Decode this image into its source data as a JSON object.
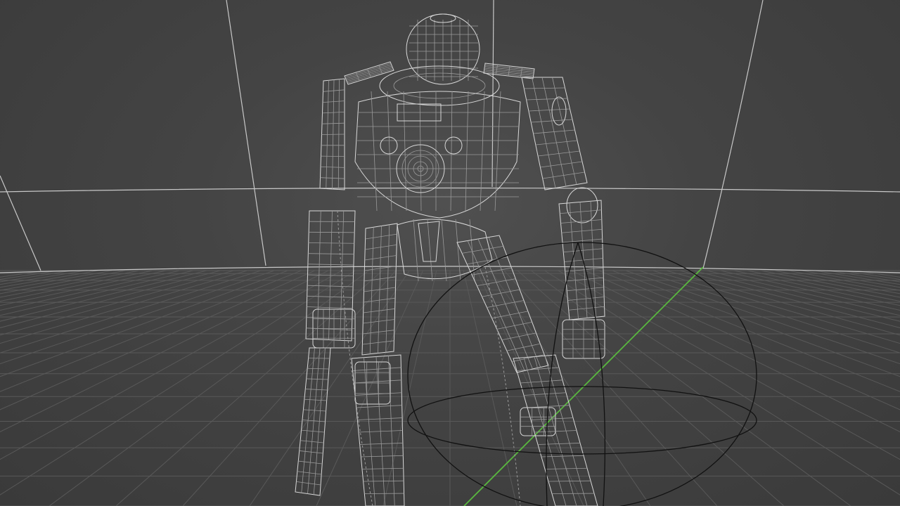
{
  "viewport": {
    "label": "",
    "shading": "wireframe",
    "scene_objects": [
      "wireframe-robot",
      "bounding-sphere-empty",
      "studio-backdrop",
      "floor-grid"
    ]
  },
  "colors": {
    "background": "#4a4a4a",
    "grid": "#595959",
    "backdrop_edge": "#c8c8c8",
    "wire": "#d8d8d8",
    "wire_dim": "#9a9a9a",
    "y_axis": "#59b83f",
    "sphere": "#111111"
  },
  "icons": {
    "y_axis": "axis-line-icon",
    "sphere": "empty-sphere-icon"
  }
}
